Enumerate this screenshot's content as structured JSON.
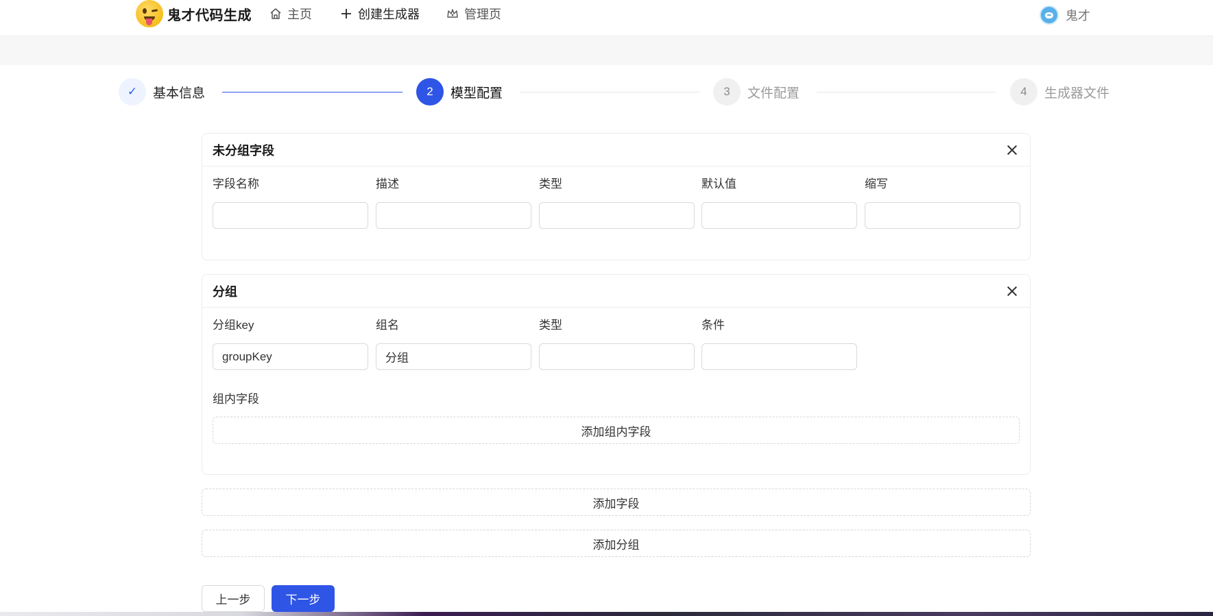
{
  "header": {
    "logo_text": "鬼才代码生成",
    "nav": {
      "home": "主页",
      "create": "创建生成器",
      "admin": "管理页"
    },
    "user_name": "鬼才"
  },
  "steps": [
    {
      "index": "✓",
      "title": "基本信息",
      "state": "done"
    },
    {
      "index": "2",
      "title": "模型配置",
      "state": "active"
    },
    {
      "index": "3",
      "title": "文件配置",
      "state": "todo"
    },
    {
      "index": "4",
      "title": "生成器文件",
      "state": "todo"
    }
  ],
  "ungrouped_panel": {
    "title": "未分组字段",
    "fields": [
      {
        "label": "字段名称",
        "value": ""
      },
      {
        "label": "描述",
        "value": ""
      },
      {
        "label": "类型",
        "value": ""
      },
      {
        "label": "默认值",
        "value": ""
      },
      {
        "label": "缩写",
        "value": ""
      }
    ]
  },
  "group_panel": {
    "title": "分组",
    "fields": [
      {
        "label": "分组key",
        "value": "groupKey"
      },
      {
        "label": "组名",
        "value": "分组"
      },
      {
        "label": "类型",
        "value": ""
      },
      {
        "label": "条件",
        "value": ""
      }
    ],
    "inner_label": "组内字段",
    "add_inner_button": "添加组内字段"
  },
  "actions": {
    "add_field": "添加字段",
    "add_group": "添加分组",
    "prev": "上一步",
    "next": "下一步"
  },
  "colors": {
    "primary": "#2f55e6",
    "border": "#d9d9d9"
  }
}
